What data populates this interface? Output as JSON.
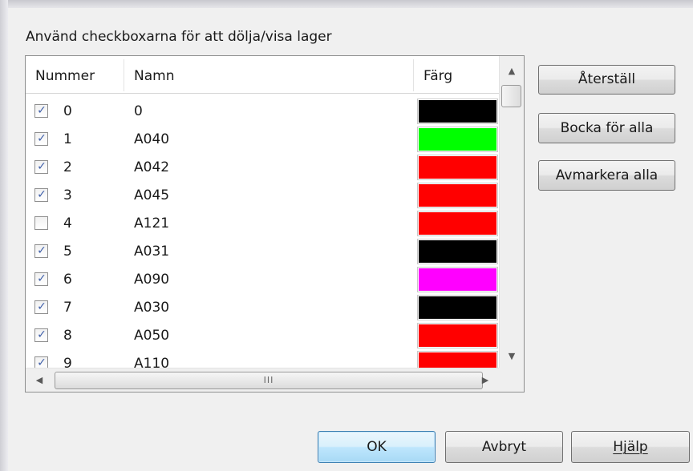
{
  "group_label": "Använd checkboxarna för att dölja/visa lager",
  "columns": {
    "number": "Nummer",
    "name": "Namn",
    "color": "Färg"
  },
  "rows": [
    {
      "checked": true,
      "number": "0",
      "name": "0",
      "color": "#000000"
    },
    {
      "checked": true,
      "number": "1",
      "name": "A040",
      "color": "#00ff00"
    },
    {
      "checked": true,
      "number": "2",
      "name": "A042",
      "color": "#ff0000"
    },
    {
      "checked": true,
      "number": "3",
      "name": "A045",
      "color": "#ff0000"
    },
    {
      "checked": false,
      "number": "4",
      "name": "A121",
      "color": "#ff0000"
    },
    {
      "checked": true,
      "number": "5",
      "name": "A031",
      "color": "#000000"
    },
    {
      "checked": true,
      "number": "6",
      "name": "A090",
      "color": "#ff00ff"
    },
    {
      "checked": true,
      "number": "7",
      "name": "A030",
      "color": "#000000"
    },
    {
      "checked": true,
      "number": "8",
      "name": "A050",
      "color": "#ff0000"
    },
    {
      "checked": true,
      "number": "9",
      "name": "A110",
      "color": "#ff0000"
    }
  ],
  "side_buttons": {
    "reset": "Återställ",
    "check_all": "Bocka för alla",
    "uncheck_all": "Avmarkera alla"
  },
  "footer_buttons": {
    "ok": "OK",
    "cancel": "Avbryt",
    "help": "Hjälp"
  },
  "scrollbar": {
    "h_grip": "III"
  },
  "icons": {
    "scroll_up": "scroll-up-arrow-icon",
    "scroll_down": "scroll-down-arrow-icon",
    "scroll_left": "scroll-left-arrow-icon",
    "scroll_right": "scroll-right-arrow-icon",
    "check": "checkmark-icon"
  }
}
